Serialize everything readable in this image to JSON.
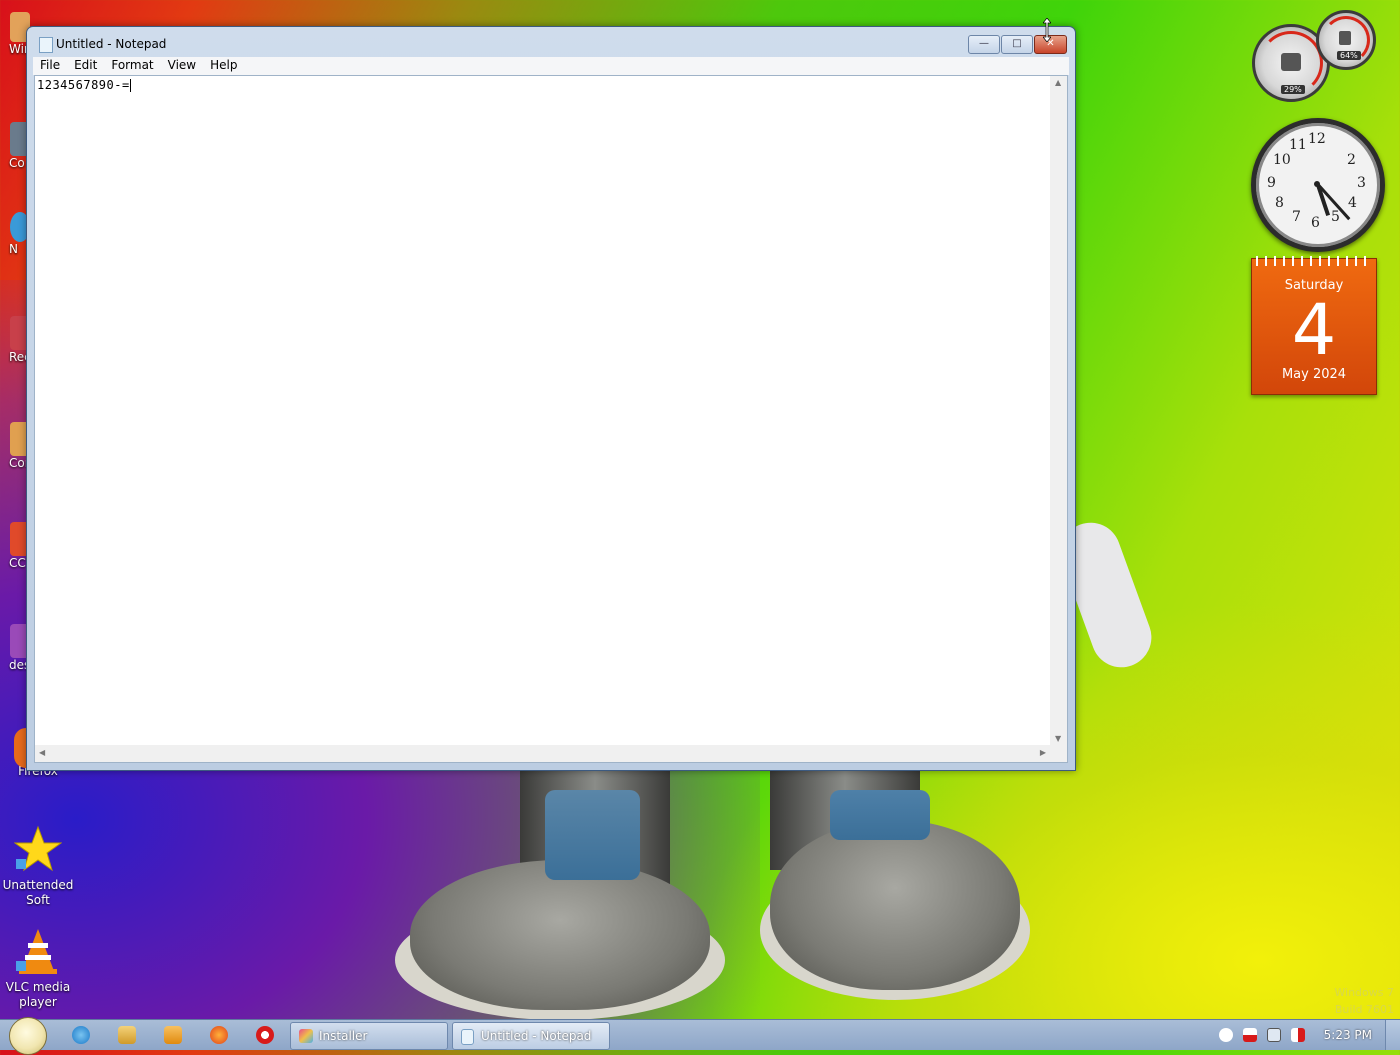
{
  "desktop": {
    "left_icons": [
      {
        "label": "Wir"
      },
      {
        "label": "Co"
      },
      {
        "label": "N"
      },
      {
        "label": "Rec"
      },
      {
        "label": "Con"
      },
      {
        "label": "CC"
      },
      {
        "label": "des"
      }
    ],
    "firefox_label": "Firefox",
    "unattended_label": "Unattended Soft",
    "vlc_label": "VLC media player",
    "watermark_line1": "Windows 7",
    "watermark_line2": "Build 7601"
  },
  "notepad": {
    "title": "Untitled - Notepad",
    "menu": [
      "File",
      "Edit",
      "Format",
      "View",
      "Help"
    ],
    "content": "1234567890-=",
    "minimize_symbol": "—",
    "maximize_symbol": "□",
    "close_symbol": "✕"
  },
  "gadgets": {
    "cpu_percent": "29%",
    "mem_percent": "64%",
    "clock_numbers": [
      "12",
      "1",
      "2",
      "3",
      "4",
      "5",
      "6",
      "7",
      "8",
      "9",
      "10",
      "11"
    ],
    "clock_hour": 5,
    "clock_minute": 23,
    "calendar_day_name": "Saturday",
    "calendar_day": "4",
    "calendar_month_year": "May 2024"
  },
  "taskbar": {
    "buttons": [
      {
        "label": "Installer"
      },
      {
        "label": "Untitled - Notepad"
      }
    ],
    "clock": "5:23 PM"
  },
  "colors": {
    "calendar": "#e2560c",
    "gauge_red": "#d8281a"
  }
}
